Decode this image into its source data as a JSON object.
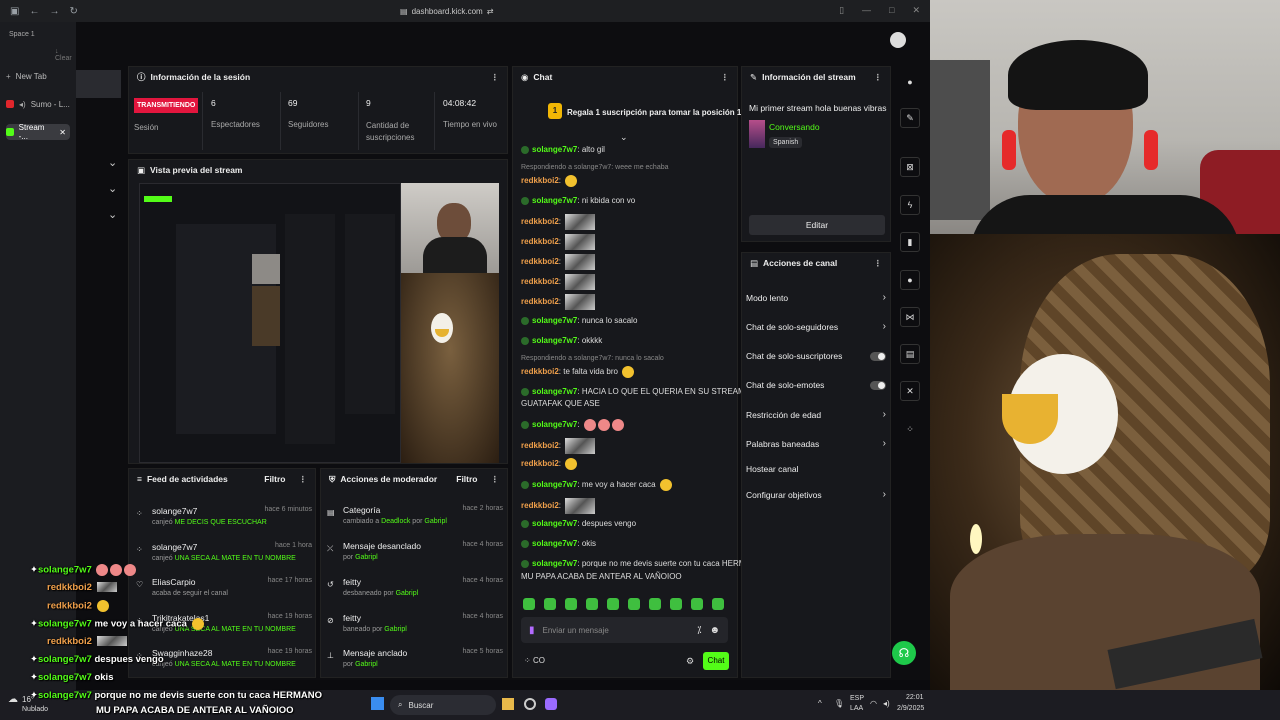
{
  "browser": {
    "url": "dashboard.kick.com",
    "space_label": "Space 1",
    "clear_label": "Clear",
    "new_tab_label": "New Tab",
    "tabs": [
      {
        "label": "Sumo - L..."
      },
      {
        "label": "Stream -..."
      }
    ]
  },
  "session": {
    "title": "Información de la sesión",
    "live_badge": "TRANSMITIENDO",
    "session_label": "Sesión",
    "stats": [
      {
        "value": "6",
        "label": "Espectadores"
      },
      {
        "value": "69",
        "label": "Seguidores"
      },
      {
        "value": "9",
        "label": "Cantidad de suscripciones"
      },
      {
        "value": "04:08:42",
        "label": "Tiempo en vivo"
      }
    ]
  },
  "preview": {
    "title": "Vista previa del stream"
  },
  "activity_feed": {
    "title": "Feed de actividades",
    "filter_label": "Filtro",
    "items": [
      {
        "user": "solange7w7",
        "time": "hace 6 minutos",
        "action": "canjeó",
        "reward": "ME DECIS QUE ESCUCHAR"
      },
      {
        "user": "solange7w7",
        "time": "hace 1 hora",
        "action": "canjeó",
        "reward": "UNA SECA AL MATE EN TU NOMBRE"
      },
      {
        "user": "EliasCarpio",
        "time": "hace 17 horas",
        "action": "acaba de seguir el canal",
        "reward": ""
      },
      {
        "user": "Trikitrakatelas1",
        "time": "hace 19 horas",
        "action": "canjeó",
        "reward": "UNA SECA AL MATE EN TU NOMBRE"
      },
      {
        "user": "Swagginhaze28",
        "time": "hace 19 horas",
        "action": "canjeó",
        "reward": "UNA SECA AL MATE EN TU NOMBRE"
      }
    ]
  },
  "mod_actions": {
    "title": "Acciones de moderador",
    "filter_label": "Filtro",
    "items": [
      {
        "title": "Categoría",
        "time": "hace 2 horas",
        "pre": "cambiado a",
        "target": "Deadlock",
        "by": "por",
        "mod": "Gabripl"
      },
      {
        "title": "Mensaje desanclado",
        "time": "hace 4 horas",
        "pre": "",
        "target": "",
        "by": "por",
        "mod": "Gabripl"
      },
      {
        "title": "feitty",
        "time": "hace 4 horas",
        "pre": "desbaneado",
        "target": "",
        "by": "por",
        "mod": "Gabripl"
      },
      {
        "title": "feitty",
        "time": "hace 4 horas",
        "pre": "baneado",
        "target": "",
        "by": "por",
        "mod": "Gabripl"
      },
      {
        "title": "Mensaje anclado",
        "time": "hace 5 horas",
        "pre": "",
        "target": "",
        "by": "por",
        "mod": "Gabripl"
      }
    ]
  },
  "chat": {
    "title": "Chat",
    "sub_goal": "Regala 1 suscripción para tomar la posición 1",
    "sub_rank": "1",
    "messages": [
      {
        "user": "solange7w7",
        "color": "g",
        "text": "alto gil"
      },
      {
        "reply": "Respondiendo a solange7w7: weee me echaba"
      },
      {
        "user": "redkkboi2",
        "color": "o",
        "text": ""
      },
      {
        "user": "solange7w7",
        "color": "g",
        "text": "ni kbida con vo"
      },
      {
        "user": "redkkboi2",
        "color": "o",
        "text": ""
      },
      {
        "user": "redkkboi2",
        "color": "o",
        "text": ""
      },
      {
        "user": "redkkboi2",
        "color": "o",
        "text": ""
      },
      {
        "user": "redkkboi2",
        "color": "o",
        "text": ""
      },
      {
        "user": "redkkboi2",
        "color": "o",
        "text": ""
      },
      {
        "user": "solange7w7",
        "color": "g",
        "text": "nunca lo  sacalo"
      },
      {
        "user": "solange7w7",
        "color": "g",
        "text": "okkkk"
      },
      {
        "reply": "Respondiendo a solange7w7: nunca lo sacalo"
      },
      {
        "user": "redkkboi2",
        "color": "o",
        "text": "te falta vida bro"
      },
      {
        "user": "solange7w7",
        "color": "g",
        "text": "HACIA LO QUE EL QUERIA EN SU STREAM"
      },
      {
        "cont": "GUATAFAK QUE ASE"
      },
      {
        "user": "solange7w7",
        "color": "g",
        "text": ""
      },
      {
        "user": "redkkboi2",
        "color": "o",
        "text": ""
      },
      {
        "user": "redkkboi2",
        "color": "o",
        "text": ""
      },
      {
        "user": "solange7w7",
        "color": "g",
        "text": "me voy a hacer caca"
      },
      {
        "user": "redkkboi2",
        "color": "o",
        "text": ""
      },
      {
        "user": "solange7w7",
        "color": "g",
        "text": "despues vengo"
      },
      {
        "user": "solange7w7",
        "color": "g",
        "text": "okis"
      },
      {
        "user": "solange7w7",
        "color": "g",
        "text": "porque no me devis suerte con tu caca HERMANO"
      },
      {
        "cont": "MU PAPA ACABA DE ANTEAR AL VAÑOIOO"
      }
    ],
    "input_placeholder": "Enviar un mensaje",
    "points": "CO",
    "send_label": "Chat"
  },
  "stream_info": {
    "title": "Información del stream",
    "stream_title": "Mi primer stream hola buenas vibras aga",
    "category": "Conversando",
    "language": "Spanish",
    "edit_label": "Editar"
  },
  "channel_actions": {
    "title": "Acciones de canal",
    "items": [
      {
        "label": "Modo lento",
        "control": "arrow"
      },
      {
        "label": "Chat de solo-seguidores",
        "control": "arrow"
      },
      {
        "label": "Chat de solo-suscriptores",
        "control": "toggle"
      },
      {
        "label": "Chat de solo-emotes",
        "control": "toggle"
      },
      {
        "label": "Restricción de edad",
        "control": "arrow"
      },
      {
        "label": "Palabras baneadas",
        "control": "arrow"
      },
      {
        "label": "Hostear canal",
        "control": "none"
      },
      {
        "label": "Configurar objetivos",
        "control": "arrow"
      }
    ]
  },
  "overlay_chat": [
    {
      "user": "solange7w7",
      "color": "g",
      "text": ""
    },
    {
      "user": "redkkboi2",
      "color": "o",
      "text": ""
    },
    {
      "user": "redkkboi2",
      "color": "o",
      "text": ""
    },
    {
      "user": "solange7w7",
      "color": "g",
      "text": "me voy a hacer caca"
    },
    {
      "user": "redkkboi2",
      "color": "o",
      "text": ""
    },
    {
      "user": "solange7w7",
      "color": "g",
      "text": "despues vengo"
    },
    {
      "user": "solange7w7",
      "color": "g",
      "text": "okis"
    },
    {
      "user": "solange7w7",
      "color": "g",
      "text": "porque no me devis suerte con tu caca HERMANO"
    },
    {
      "cont": "MU PAPA ACABA DE ANTEAR AL VAÑOIOO"
    }
  ],
  "taskbar": {
    "weather_temp": "16°",
    "weather_label": "Nublado",
    "search_label": "Buscar",
    "lang_top": "ESP",
    "lang_bottom": "LAA",
    "time": "22:01",
    "date": "2/9/2025"
  },
  "colors": {
    "kick_green": "#53fc18",
    "live_red": "#e2163e",
    "user_orange": "#f0a04b"
  }
}
